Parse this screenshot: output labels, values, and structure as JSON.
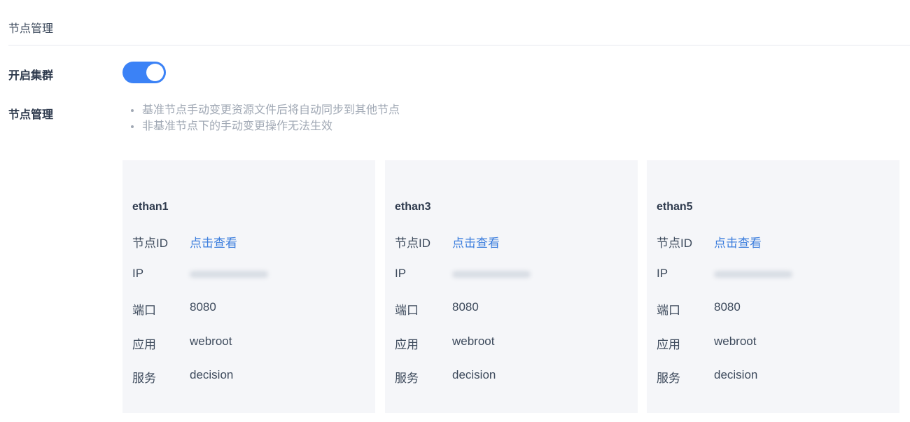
{
  "page": {
    "title": "节点管理"
  },
  "cluster": {
    "label": "开启集群",
    "enabled": true,
    "accent_color": "#3b82f6"
  },
  "node_management": {
    "label": "节点管理",
    "tips": [
      "基准节点手动变更资源文件后将自动同步到其他节点",
      "非基准节点下的手动变更操作无法生效"
    ]
  },
  "field_labels": {
    "node_id": "节点ID",
    "ip": "IP",
    "port": "端口",
    "app": "应用",
    "service": "服务"
  },
  "nodes": [
    {
      "name": "ethan1",
      "node_id_link": "点击查看",
      "port": "8080",
      "app": "webroot",
      "service": "decision"
    },
    {
      "name": "ethan3",
      "node_id_link": "点击查看",
      "port": "8080",
      "app": "webroot",
      "service": "decision"
    },
    {
      "name": "ethan5",
      "node_id_link": "点击查看",
      "port": "8080",
      "app": "webroot",
      "service": "decision"
    }
  ]
}
